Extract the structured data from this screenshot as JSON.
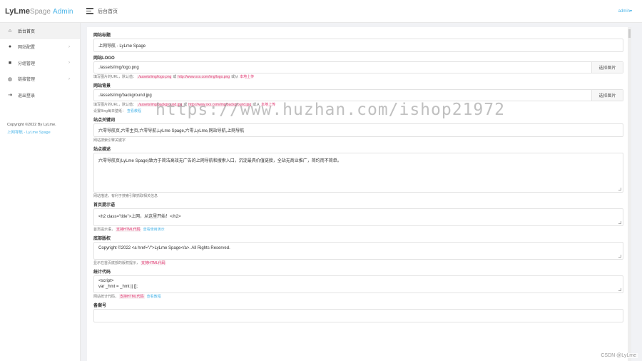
{
  "header": {
    "logo_lylme": "LyLme",
    "logo_spage": "Spage",
    "logo_admin": "Admin",
    "breadcrumb": "后台首页",
    "user": "admin",
    "user_caret": "▾"
  },
  "sidebar": {
    "items": [
      {
        "label": "后台首页",
        "icon": "home-icon",
        "glyph": "⌂",
        "active": true,
        "arrow": ""
      },
      {
        "label": "网站配置",
        "icon": "palette-icon",
        "glyph": "●",
        "active": false,
        "arrow": "›"
      },
      {
        "label": "分组管理",
        "icon": "folder-icon",
        "glyph": "■",
        "active": false,
        "arrow": "›"
      },
      {
        "label": "链接管理",
        "icon": "globe-icon",
        "glyph": "◍",
        "active": false,
        "arrow": "›"
      },
      {
        "label": "退出登录",
        "icon": "logout-icon",
        "glyph": "⇥",
        "active": false,
        "arrow": ""
      }
    ],
    "copyright_line1": "Copyright ©2022 By LyLme.",
    "copyright_line2": "上网导航 - LyLme Spage"
  },
  "form": {
    "site_title_label": "网站标题",
    "site_title_value": "上网导航 - LyLme Spage",
    "logo_label": "网站LOGO",
    "logo_value": "./assets/img/logo.png",
    "logo_button": "选择图片",
    "logo_help_prefix": "填写图片的URL，默认值：",
    "logo_help_code1": "./assets/img/logo.png",
    "logo_help_mid": "或",
    "logo_help_code2": "http://www.xxx.com/img/logo.png",
    "logo_help_suffix": "或从",
    "logo_help_upload": "本地上传",
    "bg_label": "网站背景",
    "bg_value": "./assets/img/background.jpg",
    "bg_button": "选择图片",
    "bg_help_prefix": "填写图片的URL，默认值：",
    "bg_help_code1": "./assets/img/background.jpg",
    "bg_help_mid": "或",
    "bg_help_code2": "http://www.xxx.com/img/background.jpg",
    "bg_help_suffix": "或从",
    "bg_help_upload": "本地上传",
    "bg_help2_prefix": "设置Bing每日壁纸：",
    "bg_help2_link": "查看教程",
    "keywords_label": "站点关键词",
    "keywords_value": "六零导航页,六零主页,六零导航,LyLme Spage,六零,LyLme,网站导航,上网导航",
    "keywords_help": "网站搜索引擎关键字",
    "desc_label": "站点描述",
    "desc_value": "六零导航页(LyLme Spage)致力于简洁高效无广告的上网导航和搜索入口，沉淀最具价值链接，全站无商业推广，简约而不简单。",
    "desc_help": "网站描述，有利于搜索引擎抓取相关信息",
    "home_tip_label": "首页提示语",
    "home_tip_value": "<h2 class=\"title\">上网，从这里开始！</h2>",
    "home_tip_help": "首页提示语，",
    "home_tip_html": "支持HTML代码",
    "home_tip_link": "查看使用演示",
    "footer_label": "底部版权",
    "footer_value": "Copyright ©2022 <a href=\"/\">LyLme Spage</a>.  All Rights Reserved.",
    "footer_help": "显示在首页底部的版权提示，",
    "footer_html": "支持HTML代码",
    "stats_label": "统计代码",
    "stats_value_line1": "<script>",
    "stats_value_line2": "var _hmt = _hmt || [];",
    "stats_help": "网站统计代码，",
    "stats_html": "支持HTML代码",
    "stats_link": "查看教程",
    "icp_label": "备案号"
  },
  "overlay": {
    "watermark": "https://www.huzhan.com/ishop21972",
    "csdn": "CSDN @LyLme"
  }
}
